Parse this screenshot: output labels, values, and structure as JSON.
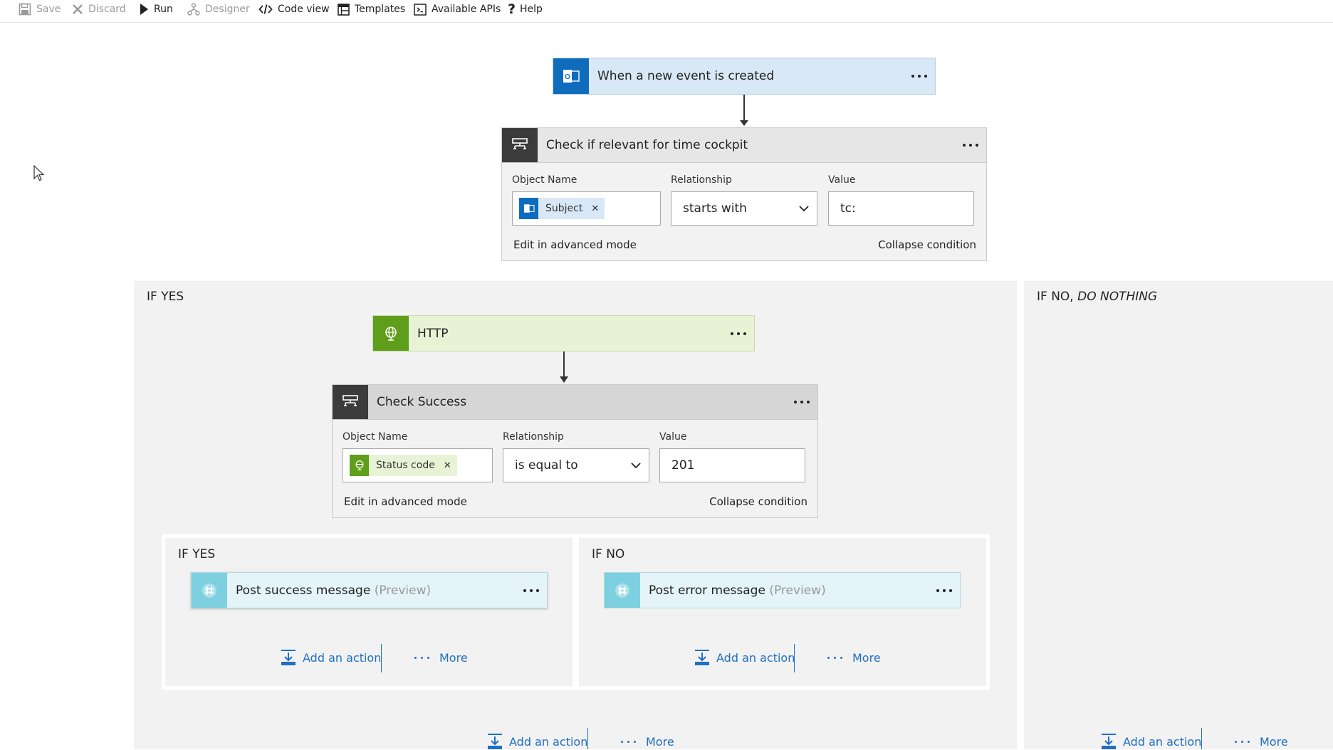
{
  "toolbar": {
    "save": "Save",
    "discard": "Discard",
    "run": "Run",
    "designer": "Designer",
    "code_view": "Code view",
    "templates": "Templates",
    "available_apis": "Available APIs",
    "help": "Help"
  },
  "trigger": {
    "title": "When a new event is created",
    "icon": "outlook-icon",
    "color": "#d8e8f7",
    "icon_color": "#0f6cbd"
  },
  "condition1": {
    "title": "Check if relevant for time cockpit",
    "labels": {
      "object_name": "Object Name",
      "relationship": "Relationship",
      "value": "Value"
    },
    "token": "Subject",
    "relationship": "starts with",
    "value": "tc:",
    "edit_advanced": "Edit in advanced mode",
    "collapse": "Collapse condition"
  },
  "if_yes_outer": {
    "label": "IF YES",
    "http": {
      "title": "HTTP",
      "color": "#e8f3d6",
      "icon_color": "#5f9e1b"
    },
    "condition2": {
      "title": "Check Success",
      "labels": {
        "object_name": "Object Name",
        "relationship": "Relationship",
        "value": "Value"
      },
      "token": "Status code",
      "relationship": "is equal to",
      "value": "201",
      "edit_advanced": "Edit in advanced mode",
      "collapse": "Collapse condition"
    },
    "inner_yes": {
      "label": "IF YES",
      "action_title": "Post success message",
      "preview": "(Preview)",
      "add_action": "Add an action",
      "more": "More"
    },
    "inner_no": {
      "label": "IF NO",
      "action_title": "Post error message",
      "preview": "(Preview)",
      "add_action": "Add an action",
      "more": "More"
    },
    "add_action": "Add an action",
    "more": "More"
  },
  "if_no_outer": {
    "label_plain": "IF NO, ",
    "label_italic": "DO NOTHING",
    "add_action": "Add an action",
    "more": "More"
  },
  "colors": {
    "slack_accent": "#7cd0e0",
    "slack_bg": "#e4f4f8",
    "condition_dark": "#3b3b3b",
    "condition_head": "#e6e6e6",
    "link_blue": "#1f6fc2"
  }
}
